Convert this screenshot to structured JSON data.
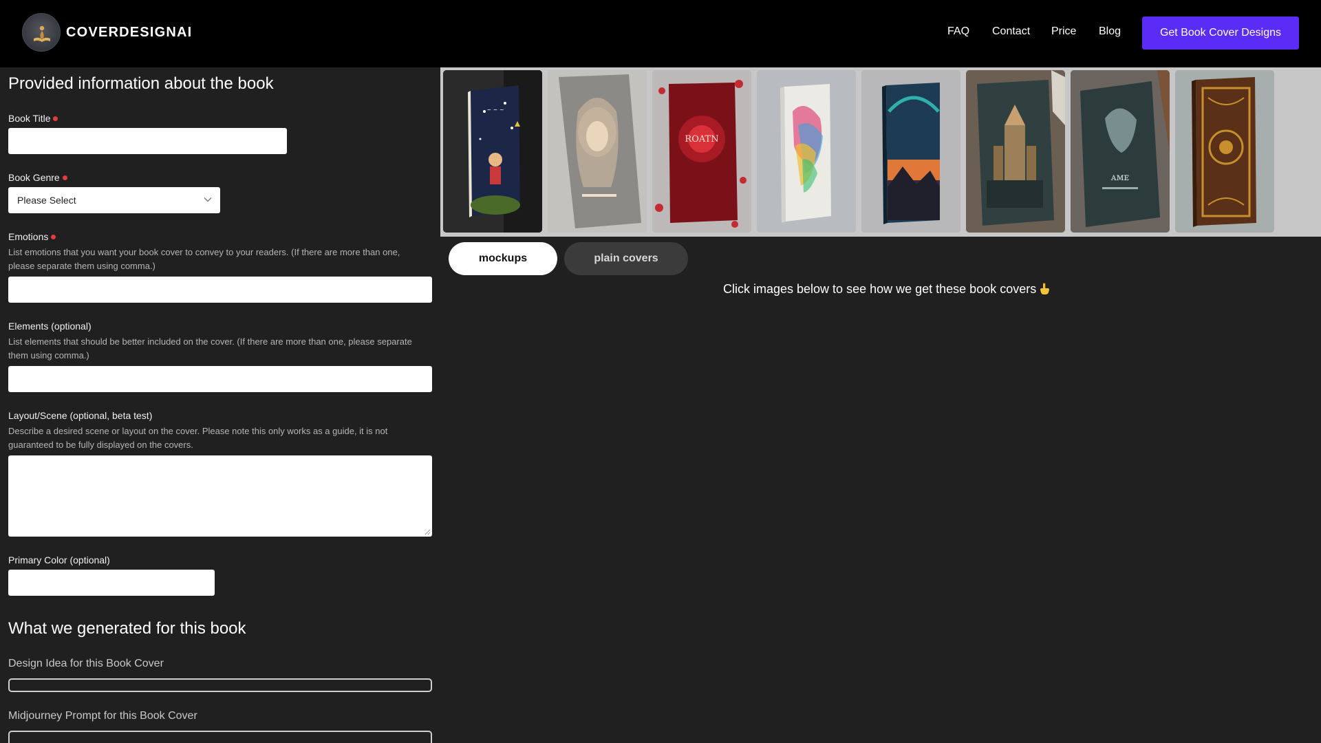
{
  "header": {
    "brand": "COVERDESIGNAI",
    "nav": [
      {
        "label": "FAQ"
      },
      {
        "label": "Contact"
      },
      {
        "label": "Price"
      },
      {
        "label": "Blog"
      }
    ],
    "cta_label": "Get Book Cover Designs",
    "cta_color": "#5b2cf5"
  },
  "form": {
    "section_title": "Provided information about the book",
    "book_title": {
      "label": "Book Title",
      "value": ""
    },
    "book_genre": {
      "label": "Book Genre",
      "selected": "Please Select"
    },
    "emotions": {
      "label": "Emotions",
      "help": "List emotions that you want your book cover to convey to your readers. (If there are more than one, please separate them using comma.)",
      "value": ""
    },
    "elements": {
      "label": "Elements (optional)",
      "help": "List elements that should be better included on the cover. (If there are more than one, please separate them using comma.)",
      "value": ""
    },
    "layout": {
      "label": "Layout/Scene (optional, beta test)",
      "help": "Describe a desired scene or layout on the cover. Please note this only works as a guide, it is not guaranteed to be fully displayed on the covers.",
      "value": ""
    },
    "primary_color": {
      "label": "Primary Color (optional)",
      "value": ""
    },
    "required_color": "#e53b3b"
  },
  "generated": {
    "section_title": "What we generated for this book",
    "design_idea_label": "Design Idea for this Book Cover",
    "prompt_label": "Midjourney Prompt for this Book Cover"
  },
  "gallery": {
    "covers": [
      {
        "name": "children-storybook-cover",
        "text": "",
        "bg": "#1c2748",
        "accent": "#d8a05a"
      },
      {
        "name": "fantasy-woman-portrait-cover",
        "text": "",
        "bg": "#8c8a86",
        "accent": "#e8d8c0"
      },
      {
        "name": "red-roses-cover",
        "text": "ROATN",
        "bg": "#7a1018",
        "accent": "#d9303a"
      },
      {
        "name": "watercolor-rainbow-cover",
        "text": "",
        "bg": "#eceae4",
        "accent": "#e04a7c"
      },
      {
        "name": "cosmic-sunset-cover",
        "text": "",
        "bg": "#1d3c54",
        "accent": "#e0783a"
      },
      {
        "name": "fantasy-castle-cover",
        "text": "",
        "bg": "#304040",
        "accent": "#b89060"
      },
      {
        "name": "dark-gothic-cover",
        "text": "",
        "bg": "#2c3c3c",
        "accent": "#9ab0b0"
      },
      {
        "name": "ornate-gold-cover",
        "text": "",
        "bg": "#5a3018",
        "accent": "#c8902c"
      }
    ],
    "tabs": {
      "active": "mockups",
      "inactive": "plain covers"
    },
    "hint": "Click images below to see how we get these book covers"
  }
}
